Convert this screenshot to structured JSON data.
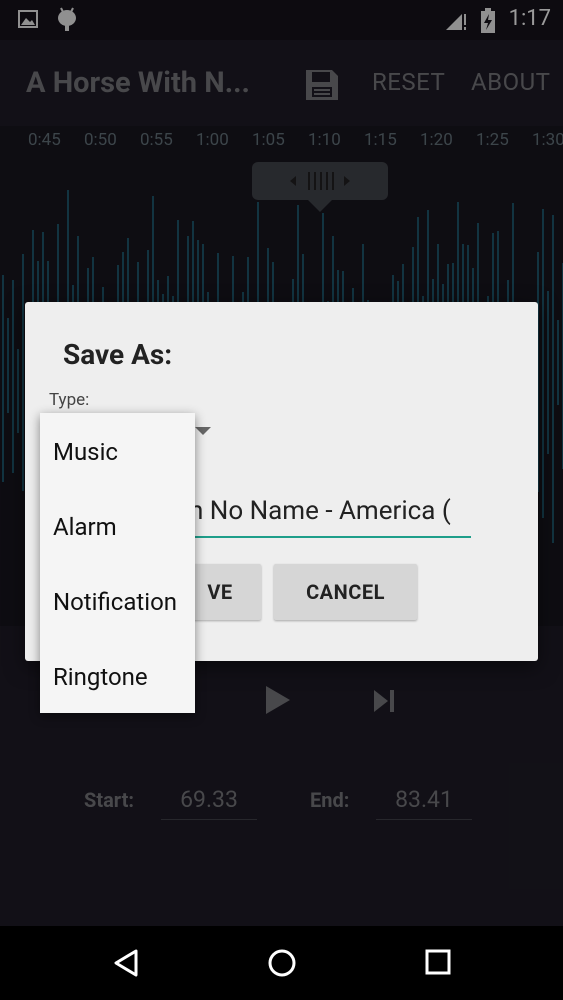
{
  "status_bar": {
    "time": "1:17"
  },
  "action_bar": {
    "title": "A Horse With N...",
    "reset_label": "RESET",
    "about_label": "ABOUT"
  },
  "timeline": {
    "ticks": [
      "0:45",
      "0:50",
      "0:55",
      "1:00",
      "1:05",
      "1:10",
      "1:15",
      "1:20",
      "1:25",
      "1:30"
    ]
  },
  "controls": {
    "start_label": "Start:",
    "start_value": "69.33",
    "end_label": "End:",
    "end_value": "83.41"
  },
  "dialog": {
    "title": "Save As:",
    "type_label": "Type:",
    "name_value": "h No Name - America (",
    "save_label": "VE",
    "cancel_label": "CANCEL"
  },
  "type_options": [
    "Music",
    "Alarm",
    "Notification",
    "Ringtone"
  ],
  "colors": {
    "accent": "#1e9e8a",
    "waveform": "#1f5c72",
    "background": "#1c1a24"
  }
}
